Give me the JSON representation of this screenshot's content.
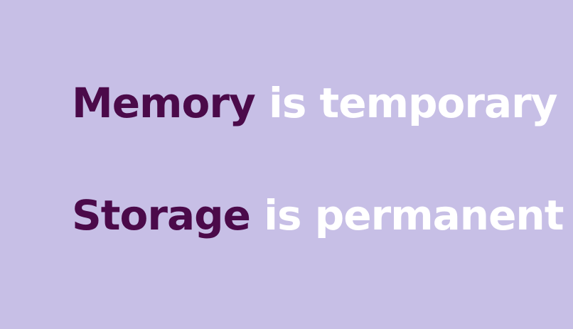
{
  "colors": {
    "background": "#c7bfe6",
    "keyword": "#4b0a4a",
    "rest": "#ffffff"
  },
  "lines": [
    {
      "keyword": "Memory",
      "rest": " is temporary"
    },
    {
      "keyword": "Storage",
      "rest": " is permanent"
    }
  ]
}
